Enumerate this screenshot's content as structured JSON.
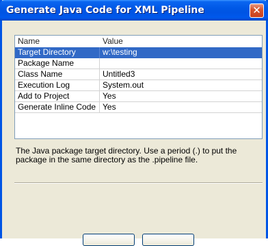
{
  "window": {
    "title": "Generate Java Code for XML Pipeline",
    "close_glyph": "✕"
  },
  "table": {
    "columns": [
      "Name",
      "Value"
    ],
    "rows": [
      {
        "name": "Target Directory",
        "value": "w:\\testing",
        "selected": true
      },
      {
        "name": "Package Name",
        "value": "",
        "selected": false
      },
      {
        "name": "Class Name",
        "value": "Untitled3",
        "selected": false
      },
      {
        "name": "Execution Log",
        "value": "System.out",
        "selected": false
      },
      {
        "name": "Add to Project",
        "value": "Yes",
        "selected": false
      },
      {
        "name": "Generate Inline Code",
        "value": "Yes",
        "selected": false
      }
    ]
  },
  "description": "The Java package target directory. Use a period (.) to put the package in the same directory as the .pipeline file.",
  "buttons": {
    "ok_label": "",
    "cancel_label": ""
  },
  "colors": {
    "titlebar": "#0054e3",
    "selection": "#3169c6",
    "dialog_bg": "#ece9d8",
    "close_button": "#d8572e"
  }
}
